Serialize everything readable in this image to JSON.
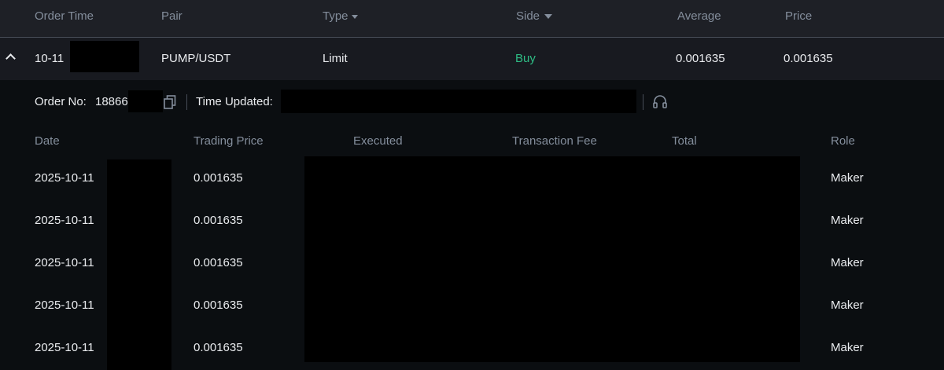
{
  "header": {
    "order_time": "Order Time",
    "pair": "Pair",
    "type": "Type",
    "side": "Side",
    "average": "Average",
    "price": "Price"
  },
  "order": {
    "time": "10-11",
    "pair": "PUMP/USDT",
    "type": "Limit",
    "side": "Buy",
    "average": "0.001635",
    "price": "0.001635"
  },
  "detail": {
    "order_no_label": "Order No:",
    "order_no_value": "18866",
    "time_updated_label": "Time Updated:"
  },
  "fills_table": {
    "columns": [
      "Date",
      "Trading Price",
      "Executed",
      "Transaction Fee",
      "Total",
      "Role"
    ],
    "rows": [
      {
        "date": "2025-10-11",
        "price": "0.001635",
        "role": "Maker"
      },
      {
        "date": "2025-10-11",
        "price": "0.001635",
        "role": "Maker"
      },
      {
        "date": "2025-10-11",
        "price": "0.001635",
        "role": "Maker"
      },
      {
        "date": "2025-10-11",
        "price": "0.001635",
        "role": "Maker"
      },
      {
        "date": "2025-10-11",
        "price": "0.001635",
        "role": "Maker"
      }
    ]
  },
  "colors": {
    "buy": "#2ebd85",
    "header_bg": "#1e2026",
    "detail_bg": "#0b0e11",
    "muted_text": "#848e9c"
  }
}
